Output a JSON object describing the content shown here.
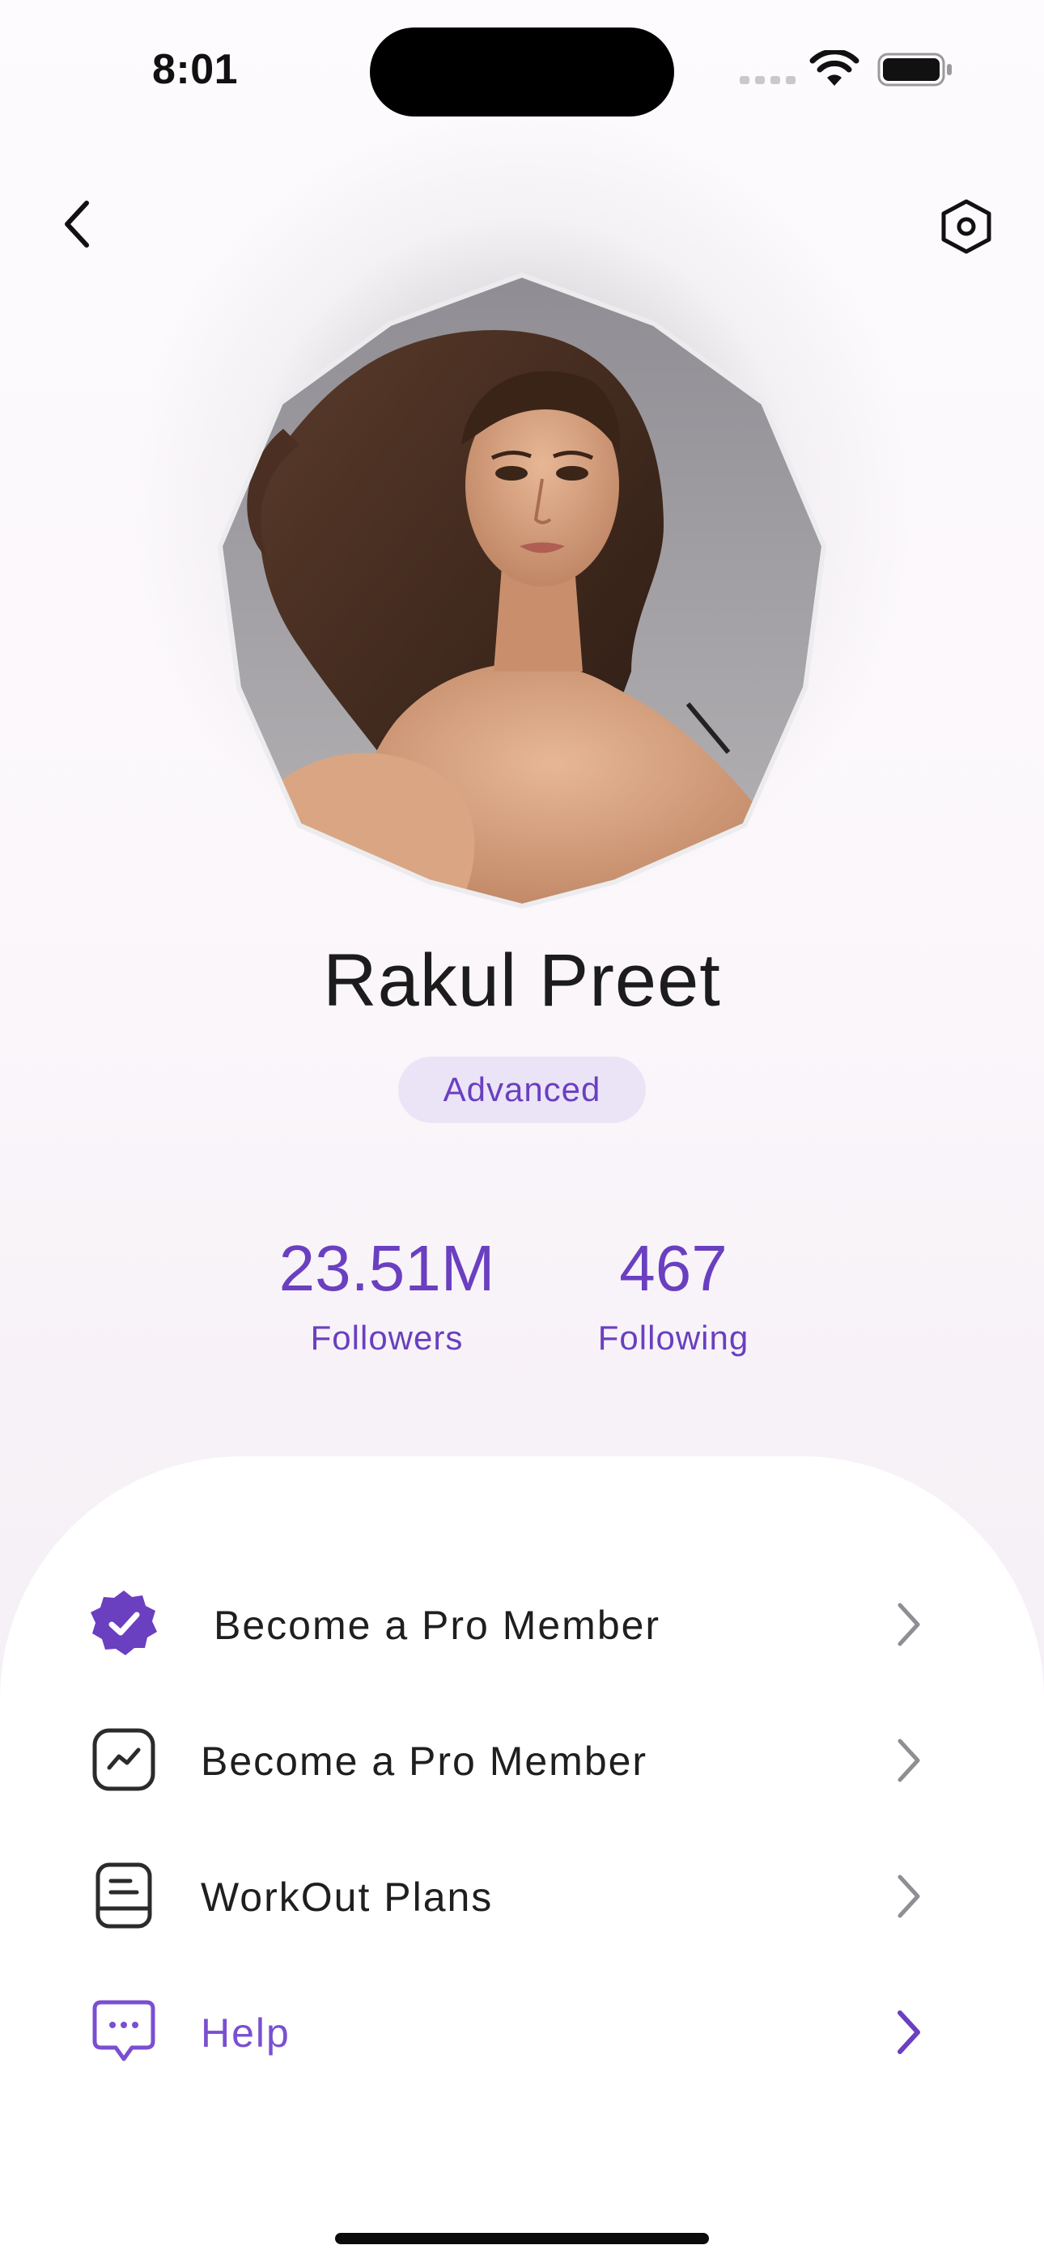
{
  "status_bar": {
    "time": "8:01",
    "signal_icon": "cellular-signal-icon",
    "wifi_icon": "wifi-icon",
    "battery_icon": "battery-icon"
  },
  "nav": {
    "back_icon": "chevron-left-icon",
    "settings_icon": "hexagon-settings-icon"
  },
  "profile": {
    "name": "Rakul Preet",
    "level": "Advanced",
    "avatar": "profile-photo"
  },
  "stats": [
    {
      "value": "23.51M",
      "label": "Followers"
    },
    {
      "value": "467",
      "label": "Following"
    }
  ],
  "menu": [
    {
      "label": "Become a Pro Member",
      "icon": "verified-badge-icon"
    },
    {
      "label": "Become a Pro Member",
      "icon": "trend-chart-icon"
    },
    {
      "label": "WorkOut Plans",
      "icon": "notebook-icon"
    },
    {
      "label": "Help",
      "icon": "chat-bubble-icon"
    }
  ],
  "colors": {
    "accent": "#6a3fc0",
    "badge_bg": "#ebe4f7",
    "text": "#1c1c1c"
  }
}
